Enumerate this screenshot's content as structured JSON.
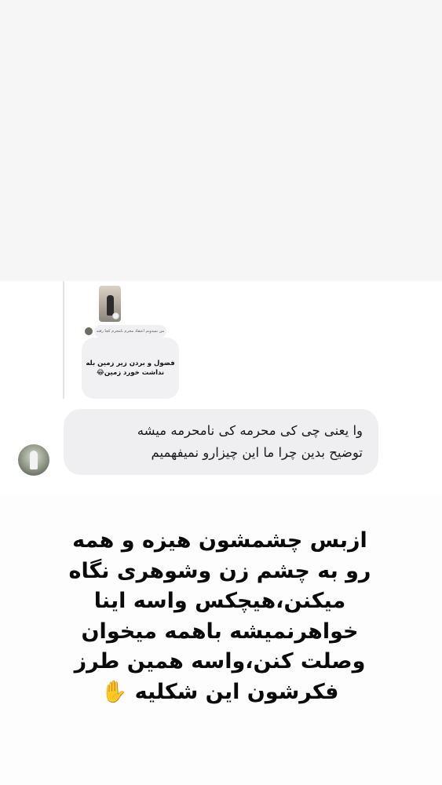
{
  "story_reply": {
    "caption": "من نمیدونم اعتقاد محرم نامحرم کجا رفته",
    "reply_text": "فضول و بردن زیر زمین بله\nنداشت خورد زمین😂"
  },
  "message": {
    "text": "وا یعنی چی کی محرمه کی نامحرمه میشه\nتوضیح بدین چرا ما این چیزارو نمیفهمیم"
  },
  "story": {
    "text": "ازبس چشمشون هیزه و همه\nرو به چشم زن وشوهری نگاه\nمیکنن،هیچکس واسه اینا\nخواهرنمیشه باهمه میخوان\nوصلت کنن،واسه همین طرز\nفکرشون این شکلیه ",
    "hand_emoji": "✋",
    "hand_icon": "raised-hand-icon"
  },
  "colors": {
    "bubble": "#efeff1",
    "background": "#ffffff",
    "text": "#0a0a0a"
  }
}
